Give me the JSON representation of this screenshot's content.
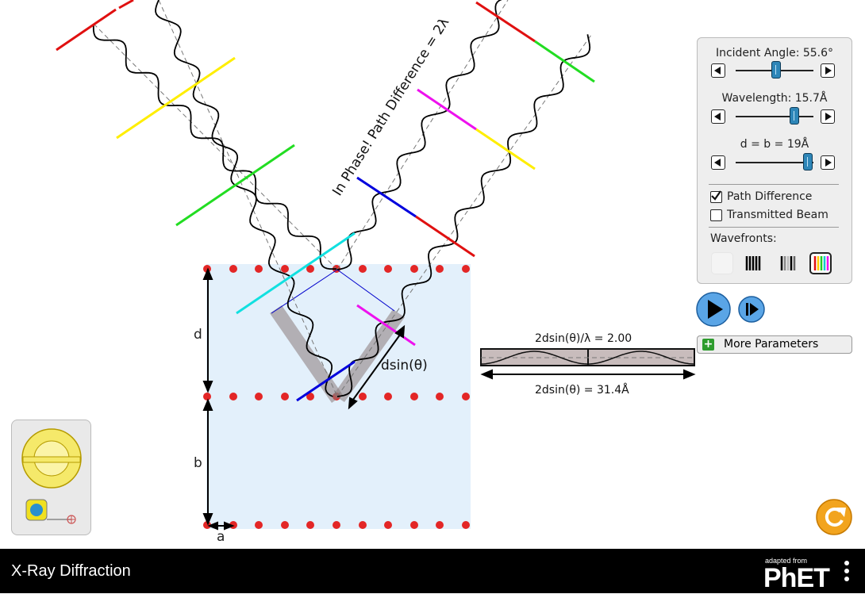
{
  "app": {
    "title": "X-Ray Diffraction",
    "adapted_from": "adapted from",
    "brand": "PhET"
  },
  "controls": {
    "incident_angle_label": "Incident Angle: 55.6°",
    "wavelength_label": "Wavelength: 15.7Å",
    "spacing_label": "d = b = 19Å",
    "incident_angle_value": 0.52,
    "wavelength_value": 0.75,
    "spacing_value": 0.93,
    "path_difference_label": "Path Difference",
    "path_difference_checked": true,
    "transmitted_beam_label": "Transmitted Beam",
    "transmitted_beam_checked": false,
    "wavefronts_label": "Wavefronts:",
    "wavefront_options": [
      "none",
      "black",
      "gray",
      "rainbow"
    ],
    "wavefront_selected": "rainbow"
  },
  "more_parameters_label": "More Parameters",
  "diagram": {
    "in_phase_text": "In Phase! Path Difference = 2λ",
    "d_label": "d",
    "b_label": "b",
    "a_label": "a",
    "dsin_label": "dsin(θ)",
    "ratio_label": "2dsin(θ)/λ = 2.00",
    "path_length_label": "2dsin(θ) = 31.4Å"
  },
  "toolbox": {
    "protractor": "protractor-icon",
    "tape_measure": "measuring-tape-icon"
  },
  "colors": {
    "lattice_bg": "#e3f0fb",
    "atom": "#e32626",
    "thumb": "#2e86b8",
    "play": "#3a8bd8",
    "reset": "#f0a020"
  }
}
